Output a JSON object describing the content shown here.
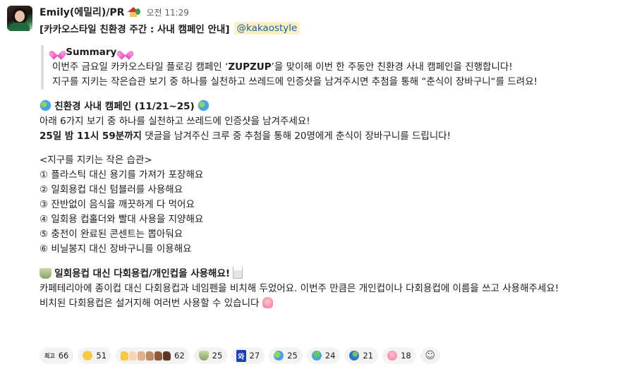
{
  "message": {
    "author": "Emily(에밀리)/PR",
    "time": "오전 11:29",
    "title": "[카카오스타일 친환경 주간 : 사내 캠페인 안내]",
    "mention": "@kakaostyle",
    "summary": {
      "heading": "Summary",
      "line1_pre": "이번주 금요일 카카오스타일 플로깅 캠페인 ‘",
      "line1_bold": "ZUPZUP",
      "line1_post": "’을 맞이해 이번 한 주동안 친환경 사내 캠페인을 진행합니다!",
      "line2": "지구를 지키는 작은습관 보기 중 하나를 실천하고 쓰레드에 인증샷을 남겨주시면 추첨을 통해 “춘식이 장바구니“를 드려요!"
    },
    "campaign": {
      "heading": "친환경 사내 캠페인 (11/21~25)",
      "line1": "아래 6가지 보기 중 하나를 실천하고 쓰레드에 인증샷을 남겨주세요!",
      "line2_bold": "25일 밤 11시 59분까지",
      "line2_rest": " 댓글을 남겨주신 크루 중 추첨을 통해 20명에게 춘식이 장바구니를 드립니다!"
    },
    "habits": {
      "heading": "<지구를 지키는 작은 습관>",
      "items": [
        "① 플라스틱 대신 용기를 가져가 포장해요",
        "② 일회용컵 대신 텀블러를 사용해요",
        "③ 잔반없이 음식을 깨끗하게 다 먹어요",
        "④ 일회용 컵홀더와 빨대 사용을 지양해요",
        "⑤ 충전이 완료된 콘센트는 뽑아둬요",
        "⑥ 비닐봉지 대신 장바구니를 이용해요"
      ]
    },
    "cups": {
      "heading": "일회용컵 대신 다회용컵/개인컵을 사용해요!",
      "line1": "카페테리아에 종이컵 대신 다회용컵과 네임펜을 비치해 두었어요. 이번주 만큼은 개인컵이나 다회용컵에 이름을 쓰고 사용해주세요!",
      "line2": "비치된 다회용컵은 설거지해 여러번 사용할 수 있습니다"
    }
  },
  "reactions": [
    {
      "label": "최고",
      "count": "66",
      "icon": "best-emoji",
      "color": "#f7d9e8"
    },
    {
      "label": "",
      "count": "51",
      "icon": "cat-face-emoji",
      "color": "#f6c94b"
    },
    {
      "label": "",
      "count": "62",
      "icon": "thumbs-up-skin-tones-emoji",
      "color": "#f2c14e"
    },
    {
      "label": "",
      "count": "25",
      "icon": "cup-emoji",
      "color": "#9fb37a"
    },
    {
      "label": "와",
      "count": "27",
      "icon": "wow-text-emoji",
      "color": "#1c3fb8"
    },
    {
      "label": "",
      "count": "25",
      "icon": "earth-emoji",
      "color": "#4aa3e0"
    },
    {
      "label": "",
      "count": "24",
      "icon": "earth-parrot-emoji",
      "color": "#6cc46a"
    },
    {
      "label": "",
      "count": "21",
      "icon": "globe-emoji",
      "color": "#2f78c4"
    },
    {
      "label": "",
      "count": "18",
      "icon": "tulip-hand-emoji",
      "color": "#f27c98"
    }
  ]
}
